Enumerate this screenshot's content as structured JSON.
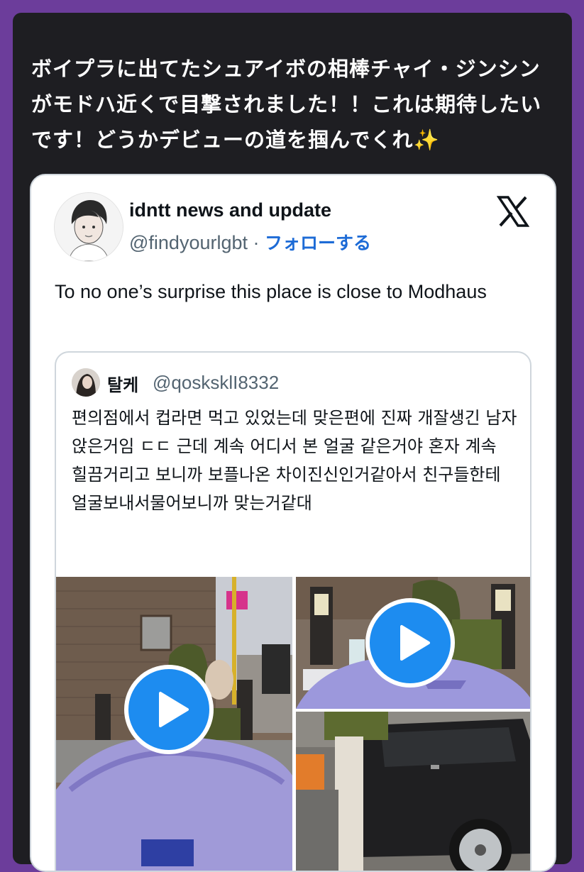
{
  "post": {
    "text": "ボイプラに出てたシュアイボの相棒チャイ・ジンシンがモドハ近くで目撃されました！！これは期待したいです！どうかデビューの道を掴んでくれ",
    "emoji": "✨"
  },
  "tweet": {
    "display_name": "idntt news and update",
    "handle": "@findyourlgbt",
    "separator": " · ",
    "follow_label": "フォローする",
    "body": "To no one’s surprise this place is close to Modhaus"
  },
  "quote": {
    "name": "탈케",
    "handle": "@qosksklI8332",
    "text": "편의점에서 컵라면 먹고 있었는데 맞은편에 진짜 개잘생긴 남자 앉은거임 ㄷㄷ 근데 계속 어디서 본 얼굴 같은거야 혼자 계속 힐끔거리고 보니까 보플나온 차이진신인거같아서 친구들한테 얼굴보내서물어보니까 맞는거같대"
  },
  "icons": {
    "logo": "x-logo-icon",
    "play": "play-icon"
  },
  "colors": {
    "background": "#6c3d9b",
    "panel": "#1e1e22",
    "accent": "#1d8cf0",
    "link": "#1d6bd6"
  }
}
